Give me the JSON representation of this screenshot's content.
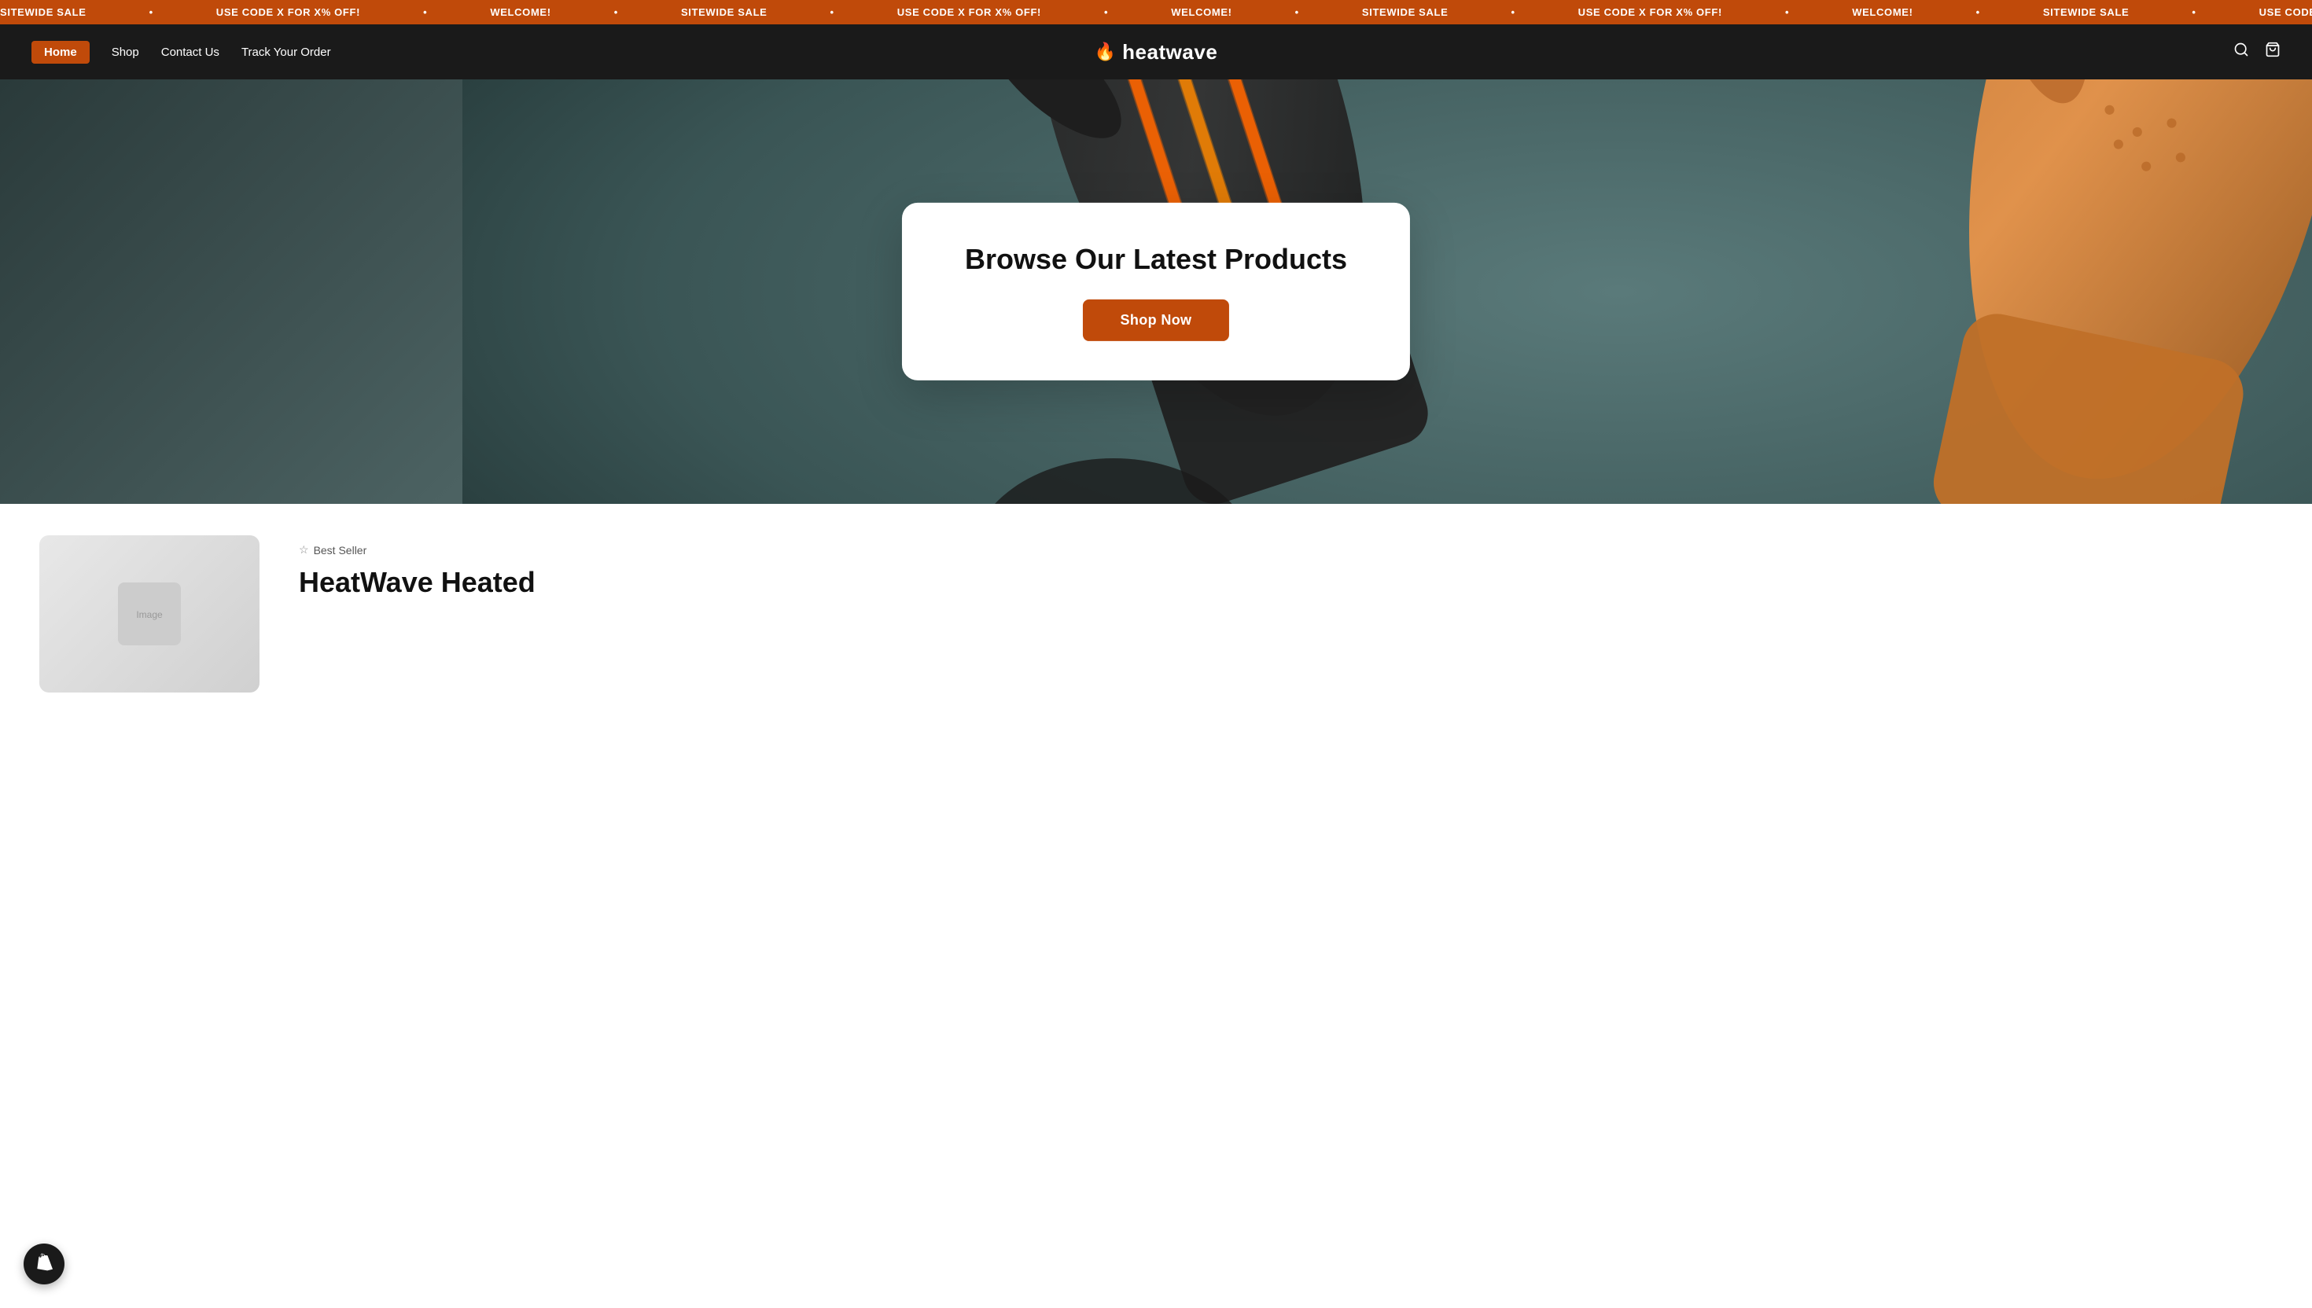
{
  "announcement": {
    "messages": [
      "SITEWIDE SALE",
      "USE CODE X FOR X% OFF!",
      "WELCOME!",
      "SITEWIDE SALE",
      "USE CODE X FOR X% OFF!",
      "WELCOME!",
      "SITEWIDE SALE",
      "USE CODE X FOR X% OFF!",
      "WELCOME!"
    ]
  },
  "nav": {
    "home_label": "Home",
    "shop_label": "Shop",
    "contact_label": "Contact Us",
    "track_label": "Track Your Order",
    "brand_name": "heatwave"
  },
  "hero": {
    "title": "Browse Our Latest Products",
    "shop_now_label": "Shop Now"
  },
  "product_section": {
    "badge_label": "Best Seller",
    "product_title": "HeatWave Heated"
  },
  "colors": {
    "accent": "#c04a0a",
    "dark": "#1a1a1a",
    "white": "#ffffff"
  }
}
